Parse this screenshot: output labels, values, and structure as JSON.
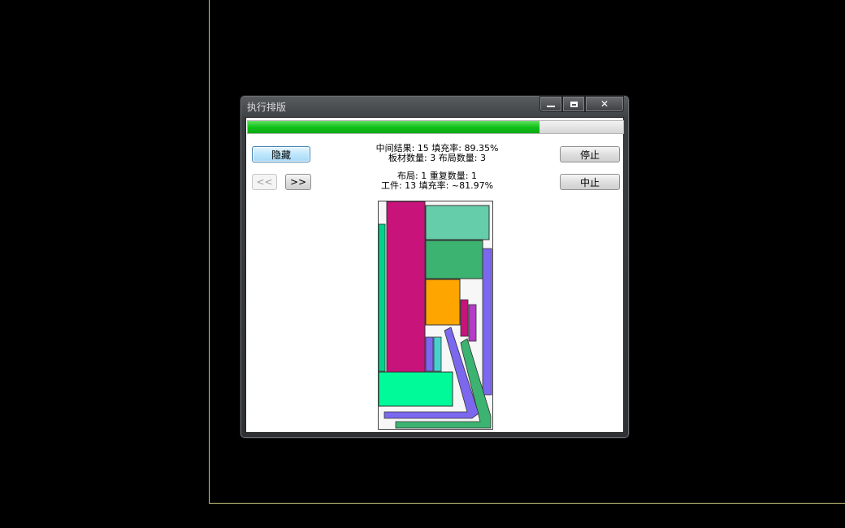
{
  "window": {
    "title": "执行排版",
    "controls": {
      "minimize": "minimize",
      "maximize": "maximize",
      "close": "✕"
    }
  },
  "progress": {
    "fraction": 0.776
  },
  "buttons": {
    "hide": "隐藏",
    "prev": "<<",
    "next": ">>",
    "pause": "停止",
    "abort": "中止"
  },
  "summary": {
    "line1": "中间结果: 15  填充率: 89.35%",
    "line2": "板材数量: 3  布局数量: 3"
  },
  "layout_info": {
    "line1": "布局: 1  重复数量: 1",
    "line2": "工件: 13  填充率: ~81.97%"
  },
  "colors": {
    "progress_fill": "#11c21a",
    "magenta": "#c8137b",
    "teal_light": "#66cdaa",
    "teal_dark": "#3cb371",
    "orange": "#ffa500",
    "green_bright": "#00fa9a",
    "purple": "#7b68ee",
    "violet": "#b43cc8"
  }
}
